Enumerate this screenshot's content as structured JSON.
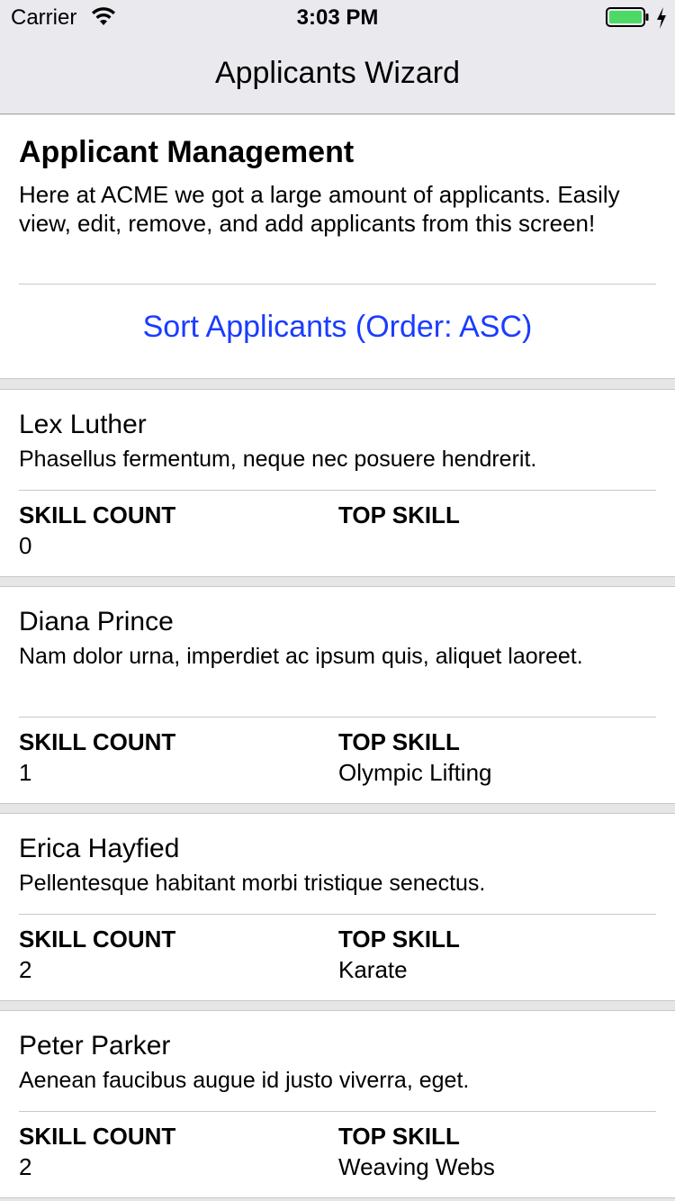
{
  "status_bar": {
    "carrier": "Carrier",
    "time": "3:03 PM",
    "battery_color": "#4cd964"
  },
  "nav": {
    "title": "Applicants Wizard"
  },
  "header": {
    "title": "Applicant Management",
    "description": "Here at ACME we got a large amount of applicants. Easily view, edit, remove, and add applicants from this screen!",
    "sort_button_label": "Sort Applicants (Order: ASC)",
    "accent_color": "#1a3cff"
  },
  "labels": {
    "skill_count": "SKILL COUNT",
    "top_skill": "TOP SKILL"
  },
  "applicants": [
    {
      "name": "Lex Luther",
      "description": "Phasellus fermentum, neque nec posuere hendrerit.",
      "skill_count": "0",
      "top_skill": ""
    },
    {
      "name": "Diana Prince",
      "description": "Nam dolor urna, imperdiet ac ipsum quis, aliquet laoreet.",
      "skill_count": "1",
      "top_skill": "Olympic Lifting"
    },
    {
      "name": "Erica Hayfied",
      "description": "Pellentesque habitant morbi tristique senectus.",
      "skill_count": "2",
      "top_skill": "Karate"
    },
    {
      "name": "Peter Parker",
      "description": "Aenean faucibus augue id justo viverra, eget.",
      "skill_count": "2",
      "top_skill": "Weaving Webs"
    }
  ]
}
